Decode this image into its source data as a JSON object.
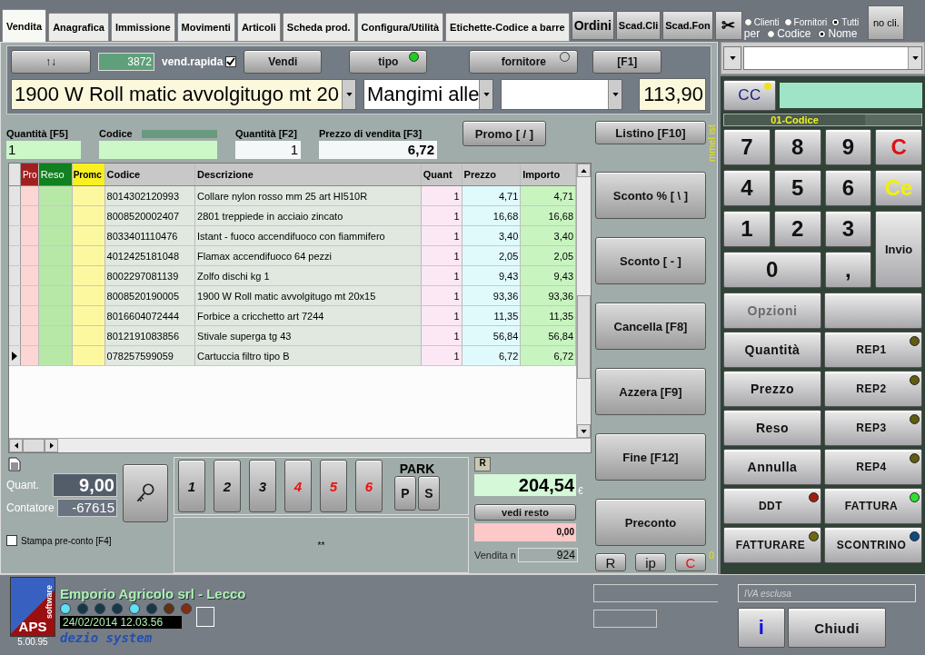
{
  "tabs": [
    {
      "label": "Vendita",
      "selected": true
    },
    {
      "label": "Anagrafica",
      "selected": false
    },
    {
      "label": "Immissione",
      "selected": false
    },
    {
      "label": "Movimenti",
      "selected": false
    },
    {
      "label": "Articoli",
      "selected": false
    },
    {
      "label": "Scheda prod.",
      "selected": false
    },
    {
      "label": "Configura/Utilità",
      "selected": false
    },
    {
      "label": "Etichette-Codice a barre",
      "selected": false
    }
  ],
  "toolbar_buttons": [
    "Ordini",
    "Scad.Cli",
    "Scad.Fon"
  ],
  "cut_button": "✂",
  "search_scope": {
    "targets": [
      {
        "label": "Clienti",
        "selected": false
      },
      {
        "label": "Fornitori",
        "selected": false
      },
      {
        "label": "Tutti",
        "selected": true
      }
    ],
    "per_label": "per",
    "by": [
      {
        "label": "Codice",
        "selected": false
      },
      {
        "label": "Nome",
        "selected": true
      }
    ]
  },
  "no_client_button": "no cli.",
  "header": {
    "sort_button": "↑↓",
    "counter": "3872",
    "quick_sale": {
      "label": "vend.rapida",
      "checked": true
    },
    "sell_button": "Vendi",
    "type_button": {
      "label": "tipo",
      "color": "#22cc22"
    },
    "supplier_button": {
      "label": "fornitore",
      "color": "#c8ccc8"
    },
    "f1_button": "[F1]",
    "product_select": "1900 W Roll matic avvolgitugo mt 20",
    "category_select": "Mangimi alle",
    "price": "113,90"
  },
  "entry": {
    "qty_f5_label": "Quantità [F5]",
    "qty_f5": "1",
    "code_label": "Codice",
    "qty_f2_label": "Quantità [F2]",
    "qty_f2": "1",
    "price_label": "Prezzo di vendita [F3]",
    "price": "6,72",
    "promo_button": "Promo  [ / ]",
    "list_button": "Listino [F10]"
  },
  "vertical_note": "mmel ist",
  "table": {
    "columns": [
      {
        "label": "Pro",
        "color": "#a02020"
      },
      {
        "label": "Reso",
        "color": "#108020"
      },
      {
        "label": "Promc",
        "color": "#f8f020"
      },
      {
        "label": "Codice"
      },
      {
        "label": "Descrizione"
      },
      {
        "label": "Quant"
      },
      {
        "label": "Prezzo"
      },
      {
        "label": "Importo"
      }
    ],
    "rows": [
      {
        "code": "8014302120993",
        "description": "Collare nylon rosso mm 25 art HI510R",
        "qty": "1",
        "price": "4,71",
        "amount": "4,71",
        "selected": false
      },
      {
        "code": "8008520002407",
        "description": "2801 treppiede in acciaio zincato",
        "qty": "1",
        "price": "16,68",
        "amount": "16,68",
        "selected": false
      },
      {
        "code": "8033401110476",
        "description": "Istant - fuoco accendifuoco con fiammifero",
        "qty": "1",
        "price": "3,40",
        "amount": "3,40",
        "selected": false
      },
      {
        "code": "4012425181048",
        "description": "Flamax accendifuoco 64 pezzi",
        "qty": "1",
        "price": "2,05",
        "amount": "2,05",
        "selected": false
      },
      {
        "code": "8002297081139",
        "description": "Zolfo dischi kg 1",
        "qty": "1",
        "price": "9,43",
        "amount": "9,43",
        "selected": false
      },
      {
        "code": "8008520190005",
        "description": "1900 W Roll matic avvolgitugo mt 20x15",
        "qty": "1",
        "price": "93,36",
        "amount": "93,36",
        "selected": false
      },
      {
        "code": "8016604072444",
        "description": "Forbice a cricchetto art 7244",
        "qty": "1",
        "price": "11,35",
        "amount": "11,35",
        "selected": false
      },
      {
        "code": "8012191083856",
        "description": "Stivale superga tg 43",
        "qty": "1",
        "price": "56,84",
        "amount": "56,84",
        "selected": false
      },
      {
        "code": "078257599059",
        "description": "Cartuccia filtro tipo B",
        "qty": "1",
        "price": "6,72",
        "amount": "6,72",
        "selected": true
      }
    ]
  },
  "side_buttons": [
    "Sconto %  [ \\ ]",
    "Sconto [ - ]",
    "Cancella [F8]",
    "Azzera  [F9]",
    "Fine [F12]",
    "Preconto"
  ],
  "bottom": {
    "qty_label": "Quant.",
    "qty": "9,00",
    "counter_label": "Contatore",
    "counter": "-67615",
    "print_preview": {
      "label": "Stampa pre-conto [F4]",
      "checked": false
    },
    "park_slots": [
      {
        "label": "1",
        "color": "#111111"
      },
      {
        "label": "2",
        "color": "#111111"
      },
      {
        "label": "3",
        "color": "#111111"
      },
      {
        "label": "4",
        "color": "#ee1111"
      },
      {
        "label": "5",
        "color": "#ee1111"
      },
      {
        "label": "6",
        "color": "#ee1111"
      }
    ],
    "park_label": "PARK",
    "park_buttons": [
      "P",
      "S"
    ],
    "note": "**",
    "r_badge": "R",
    "total": "204,54",
    "currency": "€",
    "change_button": "vedi resto",
    "change": "0,00",
    "sale_label": "Vendita n",
    "sale_number": "924",
    "small_buttons": [
      {
        "label": "R",
        "color": "#111111"
      },
      {
        "label": "ip",
        "color": "#111111"
      },
      {
        "label": "C",
        "color": "#ee1111"
      }
    ],
    "side_mark": "0"
  },
  "keypad": {
    "cc_button": {
      "label": "CC",
      "color": "#f0e020"
    },
    "field_label": "01-Codice",
    "keys": [
      {
        "label": "7",
        "kind": "digit"
      },
      {
        "label": "8",
        "kind": "digit"
      },
      {
        "label": "9",
        "kind": "digit"
      },
      {
        "label": "C",
        "kind": "clear"
      },
      {
        "label": "4",
        "kind": "digit"
      },
      {
        "label": "5",
        "kind": "digit"
      },
      {
        "label": "6",
        "kind": "digit"
      },
      {
        "label": "Ce",
        "kind": "ce"
      },
      {
        "label": "1",
        "kind": "digit"
      },
      {
        "label": "2",
        "kind": "digit"
      },
      {
        "label": "3",
        "kind": "digit"
      },
      {
        "label": "Invio",
        "kind": "enter"
      },
      {
        "label": "0",
        "kind": "zero"
      },
      {
        "label": ",",
        "kind": "digit"
      }
    ],
    "options_button": {
      "label": "Opzioni",
      "disabled": true
    },
    "functions": [
      {
        "label": "Quantità"
      },
      {
        "label": "REP1",
        "color": "#605c10"
      },
      {
        "label": "Prezzo"
      },
      {
        "label": "REP2",
        "color": "#605c10"
      },
      {
        "label": "Reso"
      },
      {
        "label": "REP3",
        "color": "#605c10"
      },
      {
        "label": "Annulla"
      },
      {
        "label": "REP4",
        "color": "#605c10"
      },
      {
        "label": "DDT",
        "color": "#a02010"
      },
      {
        "label": "FATTURA",
        "color": "#30e030"
      },
      {
        "label": "FATTURARE",
        "color": "#706810"
      },
      {
        "label": "SCONTRINO",
        "color": "#104a80"
      }
    ]
  },
  "footer": {
    "logo": {
      "name": "APS",
      "tagline": "software"
    },
    "version": "5.00.95",
    "company": "Emporio Agricolo srl  -  Lecco",
    "leds": [
      {
        "color": "#60e0f0"
      },
      {
        "color": "#183848"
      },
      {
        "color": "#183848"
      },
      {
        "color": "#183848"
      },
      {
        "color": "#60e0f0"
      },
      {
        "color": "#183848"
      },
      {
        "color": "#603010"
      },
      {
        "color": "#803010"
      }
    ],
    "datetime": "24/02/2014 12.03.56",
    "brand": "dezio system",
    "vat_placeholder": "IVA esclusa",
    "info_button": "i",
    "close_button": "Chiudi"
  }
}
